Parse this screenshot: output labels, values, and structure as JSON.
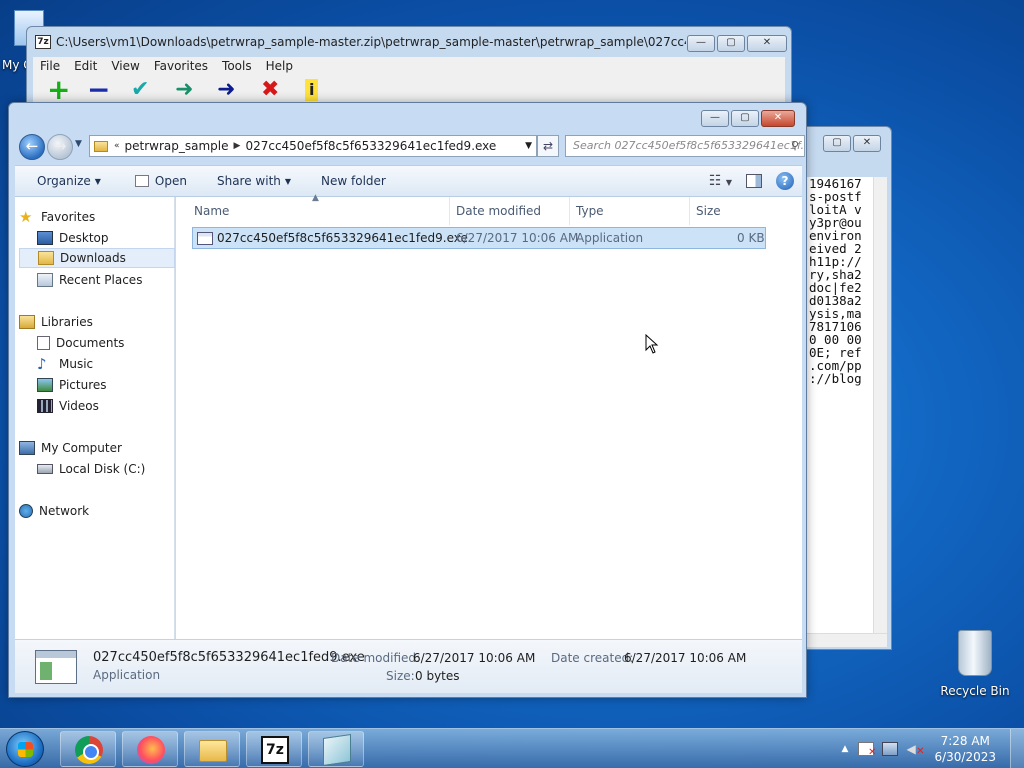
{
  "desktop": {
    "my_computer_label": "My C",
    "recycle_bin_label": "Recycle Bin"
  },
  "sevenzip_window": {
    "title": "C:\\Users\\vm1\\Downloads\\petrwrap_sample-master.zip\\petrwrap_sample-master\\petrwrap_sample\\027cc450ef5f8c5f...",
    "menu": [
      "File",
      "Edit",
      "View",
      "Favorites",
      "Tools",
      "Help"
    ],
    "toolbar": {
      "add": "+",
      "extract": "−",
      "test": "✔",
      "copy": "➜",
      "move": "➜",
      "delete": "✖",
      "info": "i"
    }
  },
  "notepad_window": {
    "lines": [
      "1946167",
      "s-postf",
      "loitA v",
      "y3pr@ou",
      "environ",
      "eived 2",
      "h11p://",
      "ry,sha2",
      "doc|fe2",
      "d0138a2",
      "ysis,ma",
      "7817106",
      "0 00 00",
      "0E; ref",
      ".com/pp",
      "://blog"
    ]
  },
  "explorer": {
    "breadcrumb": {
      "overflow": "«",
      "items": [
        "petrwrap_sample",
        "027cc450ef5f8c5f653329641ec1fed9.exe"
      ]
    },
    "search_placeholder": "Search 027cc450ef5f8c5f653329641ec1f...",
    "commands": {
      "organize": "Organize",
      "open": "Open",
      "share_with": "Share with",
      "new_folder": "New folder"
    },
    "nav": {
      "favorites": "Favorites",
      "desktop": "Desktop",
      "downloads": "Downloads",
      "recent_places": "Recent Places",
      "libraries": "Libraries",
      "documents": "Documents",
      "music": "Music",
      "pictures": "Pictures",
      "videos": "Videos",
      "my_computer": "My Computer",
      "local_disk": "Local Disk (C:)",
      "network": "Network"
    },
    "columns": {
      "name": "Name",
      "date_modified": "Date modified",
      "type": "Type",
      "size": "Size"
    },
    "files": [
      {
        "name": "027cc450ef5f8c5f653329641ec1fed9.exe",
        "date_modified": "6/27/2017 10:06 AM",
        "type": "Application",
        "size": "0 KB"
      }
    ],
    "details": {
      "filename": "027cc450ef5f8c5f653329641ec1fed9.exe",
      "type": "Application",
      "date_modified_label": "Date modified:",
      "date_modified_value": "6/27/2017 10:06 AM",
      "date_created_label": "Date created:",
      "date_created_value": "6/27/2017 10:06 AM",
      "size_label": "Size:",
      "size_value": "0 bytes"
    }
  },
  "taskbar": {
    "sevenzip_label": "7z",
    "clock_time": "7:28 AM",
    "clock_date": "6/30/2023",
    "tray_expand": "▲"
  }
}
